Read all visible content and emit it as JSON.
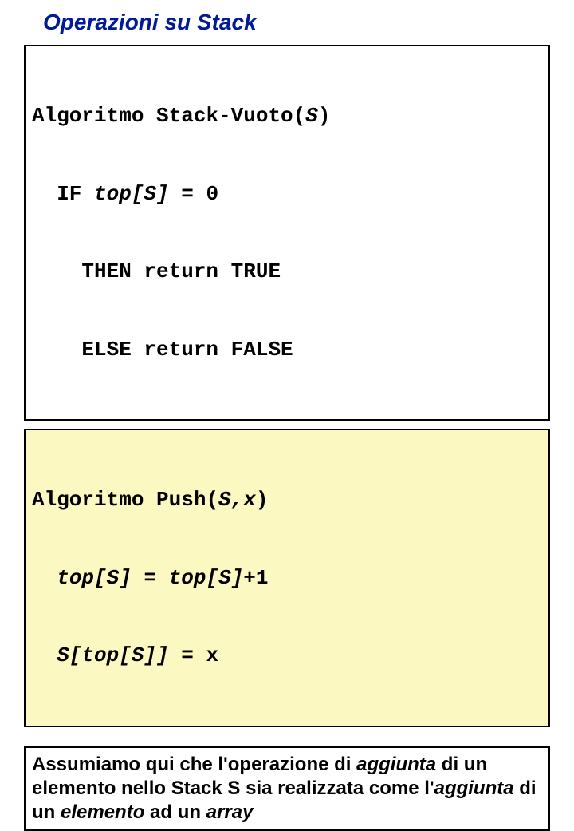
{
  "title": "Operazioni su Stack",
  "algo1": {
    "name_pre": "Algoritmo ",
    "name": "Stack-Vuoto(",
    "param": "S",
    "name_close": ")",
    "line2_pre": "  IF ",
    "line2_ital": "top[S]",
    "line2_post": " = 0",
    "line3": "    THEN return TRUE",
    "line4": "    ELSE return FALSE"
  },
  "algo2": {
    "name_pre": "Algoritmo ",
    "name": "Push(",
    "param": "S,x",
    "name_close": ")",
    "line2_pre": "  ",
    "line2_a": "top[S]",
    "line2_eq": " = ",
    "line2_b": "top[S]",
    "line2_post": "+1",
    "line3_pre": "  ",
    "line3_a": "S[top[S]]",
    "line3_eq": " = x"
  },
  "note": {
    "t1": "Assumiamo qui che l'operazione di ",
    "em1": "aggiunta",
    "t2": " di un elemento nello Stack S sia realizzata come l'",
    "em2": "aggiunta",
    "t3": " di un ",
    "em3": "elemento",
    "t4": " ad un ",
    "em4": "array"
  }
}
